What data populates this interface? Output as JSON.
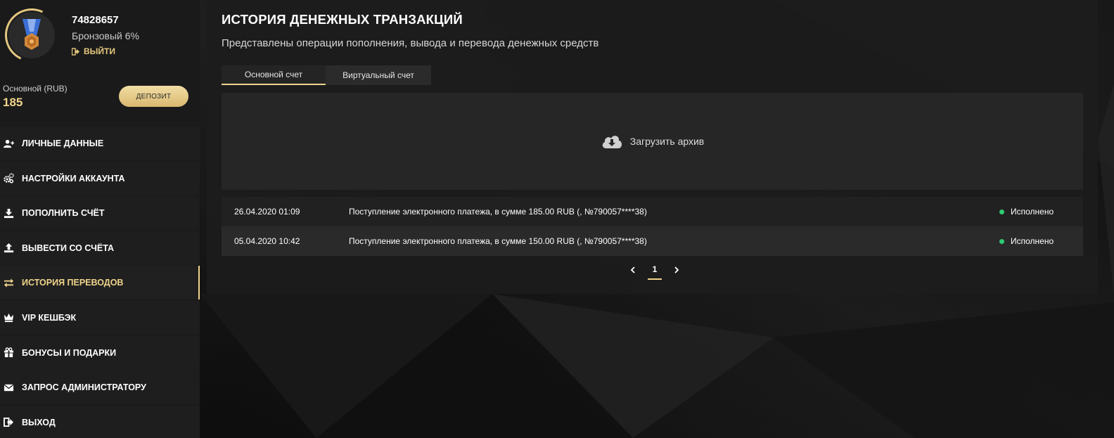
{
  "profile": {
    "username": "74828657",
    "level": "Бронзовый 6%",
    "logout_label": "ВЫЙТИ",
    "balance_label": "Основной (RUB)",
    "balance_value": "185",
    "deposit_label": "ДЕПОЗИТ"
  },
  "menu": {
    "items": [
      {
        "label": "ЛИЧНЫЕ ДАННЫЕ",
        "icon": "user-plus-icon"
      },
      {
        "label": "НАСТРОЙКИ АККАУНТА",
        "icon": "gears-icon"
      },
      {
        "label": "ПОПОЛНИТЬ СЧЁТ",
        "icon": "download-icon"
      },
      {
        "label": "ВЫВЕСТИ СО СЧЁТА",
        "icon": "upload-icon"
      },
      {
        "label": "ИСТОРИЯ ПЕРЕВОДОВ",
        "icon": "exchange-icon"
      },
      {
        "label": "VIP КЕШБЭК",
        "icon": "crown-icon"
      },
      {
        "label": "БОНУСЫ И ПОДАРКИ",
        "icon": "gift-icon"
      },
      {
        "label": "ЗАПРОС АДМИНИСТРАТОРУ",
        "icon": "envelope-icon"
      },
      {
        "label": "ВЫХОД",
        "icon": "sign-out-icon"
      }
    ],
    "active_index": 4
  },
  "main": {
    "title": "ИСТОРИЯ ДЕНЕЖНЫХ ТРАНЗАКЦИЙ",
    "subtitle": "Представлены операции пополнения, вывода и перевода денежных средств",
    "tabs": [
      {
        "label": "Основной счет",
        "active": true
      },
      {
        "label": "Виртуальный счет",
        "active": false
      }
    ],
    "archive_label": "Загрузить архив",
    "transactions": [
      {
        "date": "26.04.2020 01:09",
        "description": "Поступление электронного платежа, в сумме 185.00 RUB (, №790057****38)",
        "status": "Исполнено"
      },
      {
        "date": "05.04.2020 10:42",
        "description": "Поступление электронного платежа, в сумме 150.00 RUB (, №790057****38)",
        "status": "Исполнено"
      }
    ],
    "pagination": {
      "current_page": "1"
    }
  },
  "colors": {
    "accent": "#f0d48b",
    "status_ok": "#2ecc71",
    "background": "#121212"
  }
}
